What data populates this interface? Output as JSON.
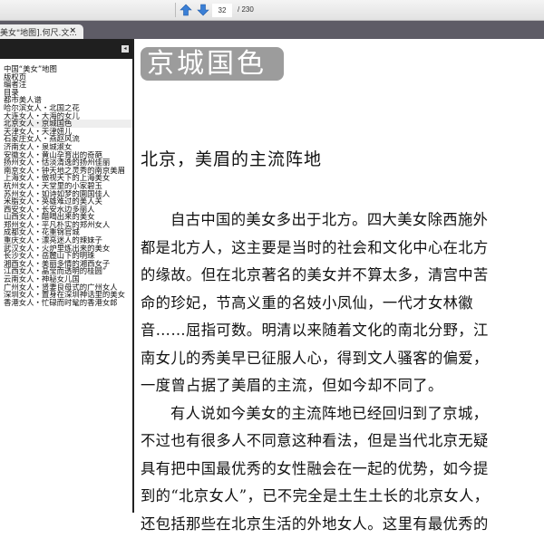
{
  "toolbar": {
    "current_page": "32",
    "total_pages": "/ 230"
  },
  "tab": {
    "title": "美女\"地图].何尺.文...",
    "close": "×"
  },
  "sidebar": {
    "collapse": "◂",
    "items": [
      "中国“美女”地图",
      "版权页",
      "编者注",
      "目录",
      "都市美人谱",
      "哈尔滨女人・北国之花",
      "大连女人・大海的女儿",
      "北京女人・京城国色",
      "天津女人・天津妞儿",
      "石家庄女人・燕赵风流",
      "济南女人・泉城淑女",
      "安徽女人・黄山孕育出的奇葩",
      "扬州女人・恬淡清逸的扬州佳丽",
      "南京女人・钟天地之灵秀的南京美眉",
      "上海女人・傲视天下的上海美女",
      "杭州女人・天堂里的小家碧玉",
      "苏州女人・如诗如梦的園国佳人",
      "米脂女人・英雄难过的美人关",
      "西安女人・长安水边多丽人",
      "山西女人・醋喝出来的美女",
      "郑州女人・平凡朴实的郑州女人",
      "成都女人・花重锦官城",
      "重庆女人・漂亮迷人的辣妹子",
      "武汉女人・火炉里炼出来的美女",
      "长沙女人・岳麓山下的明珠",
      "湘西女人・美丽多情的湘西女子",
      "江西女人・晶莹而透明的桂圆”",
      "云南女人・神秘女儿国",
      "广州女人・贤妻良母式的广州女人",
      "深圳女人・置身在深圳神话里的美女",
      "香港女人・忙碌而时髦的香港女郎"
    ],
    "selected_index": 7
  },
  "main": {
    "badge": "京城国色",
    "heading": "北京，美眉的主流阵地",
    "lines": [
      {
        "t": "自古中国的美女多出于北方。四大美女除西施外",
        "indent": true
      },
      {
        "t": "都是北方人，这主要是当时的社会和文化中心在北方",
        "indent": false
      },
      {
        "t": "的缘故。但在北京著名的美女并不算太多，清宫中苦",
        "indent": false
      },
      {
        "t": "命的珍妃，节高义重的名妓小凤仙，一代才女林徽",
        "indent": false
      },
      {
        "t": "音……屈指可数。明清以来随着文化的南北分野，江",
        "indent": false
      },
      {
        "t": "南女儿的秀美早已征服人心，得到文人骚客的偏爱，",
        "indent": false
      },
      {
        "t": "一度曾占据了美眉的主流，但如今却不同了。",
        "indent": false
      },
      {
        "t": "有人说如今美女的主流阵地已经回归到了京城，",
        "indent": true
      },
      {
        "t": "不过也有很多人不同意这种看法，但是当代北京无疑",
        "indent": false
      },
      {
        "t": "具有把中国最优秀的女性融会在一起的优势，如今提",
        "indent": false
      },
      {
        "t": "到的“北京女人”，已不完全是土生土长的北京女人，",
        "indent": false
      },
      {
        "t": "还包括那些在北京生活的外地女人。这里有最优秀的",
        "indent": false
      }
    ]
  }
}
